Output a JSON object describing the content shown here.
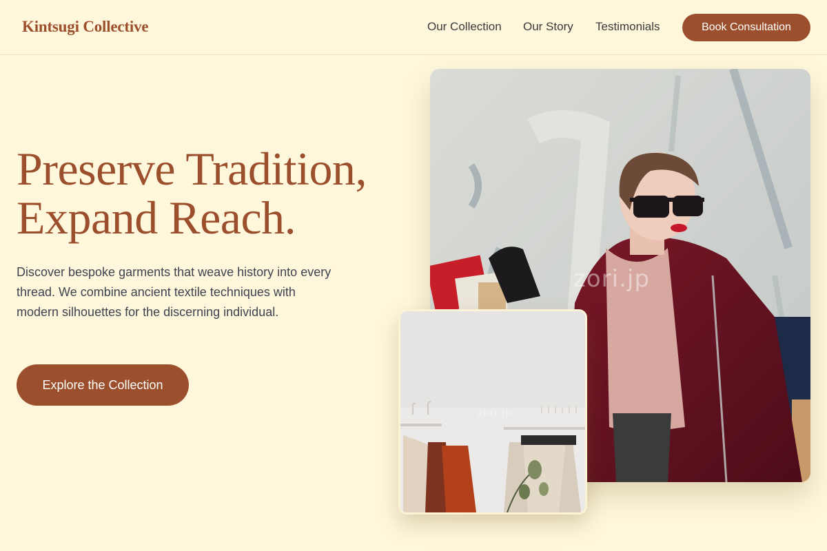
{
  "brand": {
    "name": "Kintsugi Collective"
  },
  "nav": {
    "links": [
      "Our Collection",
      "Our Story",
      "Testimonials"
    ],
    "cta": "Book Consultation"
  },
  "hero": {
    "title_line1": "Preserve Tradition,",
    "title_line2": "Expand Reach.",
    "description": "Discover bespoke garments that weave history into every thread. We combine ancient textile techniques with modern silhouettes for the discerning individual.",
    "cta": "Explore the Collection"
  },
  "images": {
    "main_alt": "Woman in burgundy coat and sunglasses carrying shopping bags",
    "secondary_alt": "Clothing rack with hangers and neutral garments",
    "watermark_main": "zori.jp",
    "watermark_small": "zori.jp"
  },
  "colors": {
    "background": "#fef7dc",
    "accent": "#9c4f2c",
    "body_text": "#3f4350"
  }
}
